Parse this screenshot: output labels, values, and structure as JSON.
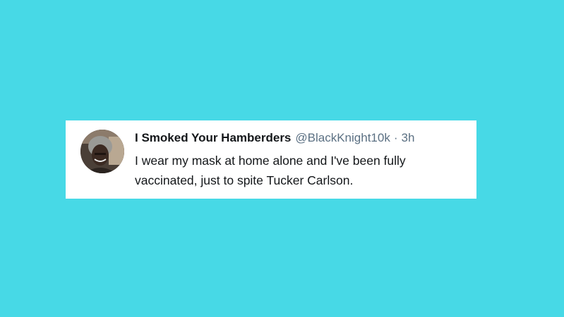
{
  "colors": {
    "background": "#47d9e6",
    "card": "#ffffff",
    "name_text": "#14171a",
    "meta_text": "#5b7083"
  },
  "tweet": {
    "avatar_icon": "user-avatar-photo",
    "display_name": "I Smoked Your Hamberders",
    "handle": "@BlackKnight10k",
    "separator": "·",
    "time": "3h",
    "text": "I wear my mask at home alone and I've been fully vaccinated, just to spite Tucker Carlson."
  }
}
